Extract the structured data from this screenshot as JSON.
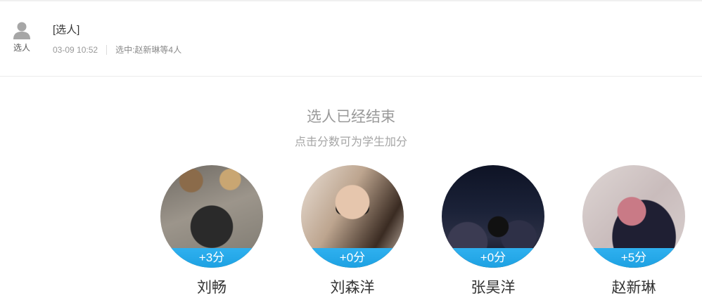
{
  "activity": {
    "icon_name": "person-icon",
    "icon_label": "选人",
    "title": "[选人]",
    "time": "03-09 10:52",
    "selected_label": "选中:",
    "selected_value": "赵新琳等4人"
  },
  "result": {
    "title": "选人已经结束",
    "subtitle": "点击分数可为学生加分"
  },
  "students": [
    {
      "name": "刘畅",
      "score": "+3分"
    },
    {
      "name": "刘森洋",
      "score": "+0分"
    },
    {
      "name": "张昊洋",
      "score": "+0分"
    },
    {
      "name": "赵新琳",
      "score": "+5分"
    }
  ],
  "colors": {
    "score_bar": "#1da1e2",
    "muted_text": "#9a9a9a"
  }
}
